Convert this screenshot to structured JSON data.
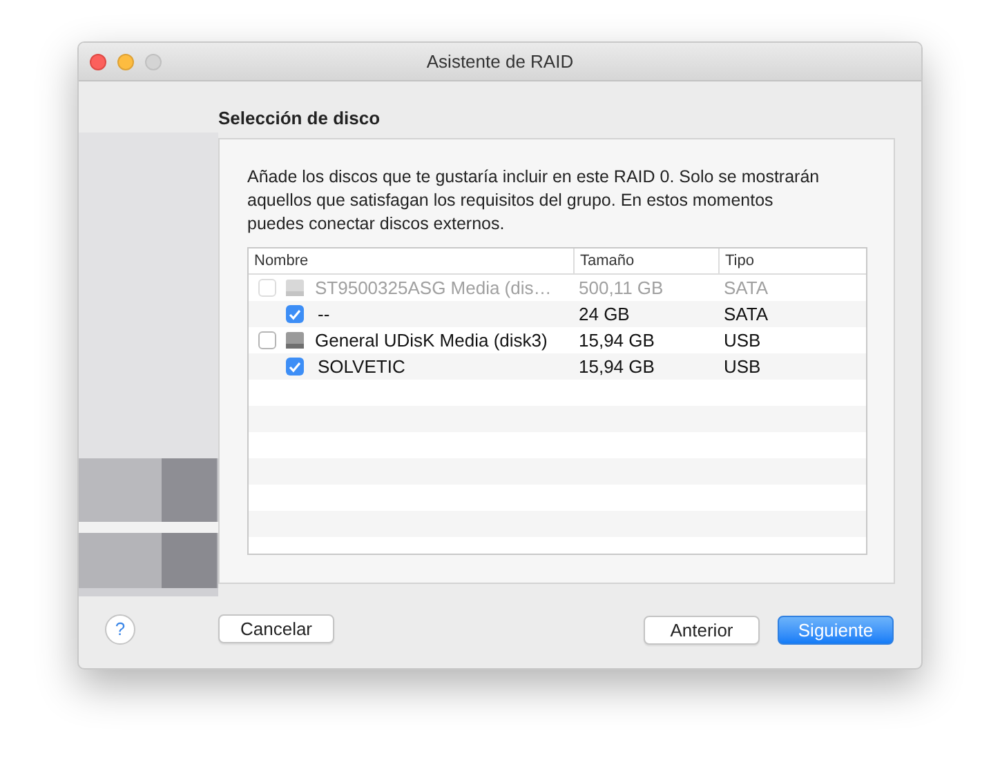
{
  "window": {
    "title": "Asistente de RAID"
  },
  "heading": "Selección de disco",
  "description": "Añade los discos que te gustaría incluir en este RAID 0. Solo se mostrarán aquellos que satisfagan los requisitos del grupo. En estos momentos puedes conectar discos externos.",
  "table": {
    "columns": [
      "Nombre",
      "Tamaño",
      "Tipo"
    ],
    "rows": [
      {
        "name": "ST9500325ASG Media (dis…",
        "size": "500,11 GB",
        "type": "SATA",
        "checked": false,
        "disabled": true,
        "children": [
          {
            "name": "--",
            "size": "24 GB",
            "type": "SATA",
            "checked": true,
            "disabled": false
          }
        ]
      },
      {
        "name": "General UDisK Media (disk3)",
        "size": "15,94 GB",
        "type": "USB",
        "checked": false,
        "disabled": false,
        "children": [
          {
            "name": "SOLVETIC",
            "size": "15,94 GB",
            "type": "USB",
            "checked": true,
            "disabled": false
          }
        ]
      }
    ]
  },
  "help": "?",
  "buttons": [
    {
      "label": "Cancelar",
      "default": false
    },
    {
      "label": "Anterior",
      "default": false
    },
    {
      "label": "Siguiente",
      "default": true
    }
  ]
}
